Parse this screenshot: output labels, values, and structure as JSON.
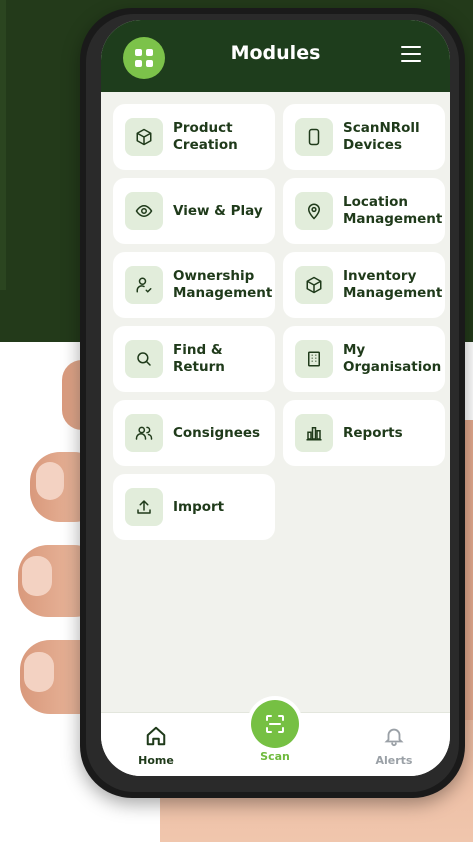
{
  "header": {
    "title": "Modules"
  },
  "modules": [
    {
      "label": "Product\nCreation",
      "icon": "box-icon"
    },
    {
      "label": "ScanNRoll\nDevices",
      "icon": "phone-device-icon"
    },
    {
      "label": "View & Play",
      "icon": "eye-icon"
    },
    {
      "label": "Location\nManagement",
      "icon": "map-pin-icon"
    },
    {
      "label": "Ownership\nManagement",
      "icon": "user-check-icon"
    },
    {
      "label": "Inventory\nManagement",
      "icon": "cube-icon"
    },
    {
      "label": "Find &\nReturn",
      "icon": "search-icon"
    },
    {
      "label": "My\nOrganisation",
      "icon": "building-icon"
    },
    {
      "label": "Consignees",
      "icon": "users-icon"
    },
    {
      "label": "Reports",
      "icon": "bar-chart-icon"
    },
    {
      "label": "Import",
      "icon": "upload-icon"
    }
  ],
  "nav": {
    "home": "Home",
    "scan": "Scan",
    "alerts": "Alerts"
  },
  "colors": {
    "header_bg": "#1e3d1c",
    "accent_green": "#76c043",
    "tile_text": "#1f3a1a",
    "icon_bg": "#e2eddb",
    "inactive": "#9aa0a6"
  }
}
